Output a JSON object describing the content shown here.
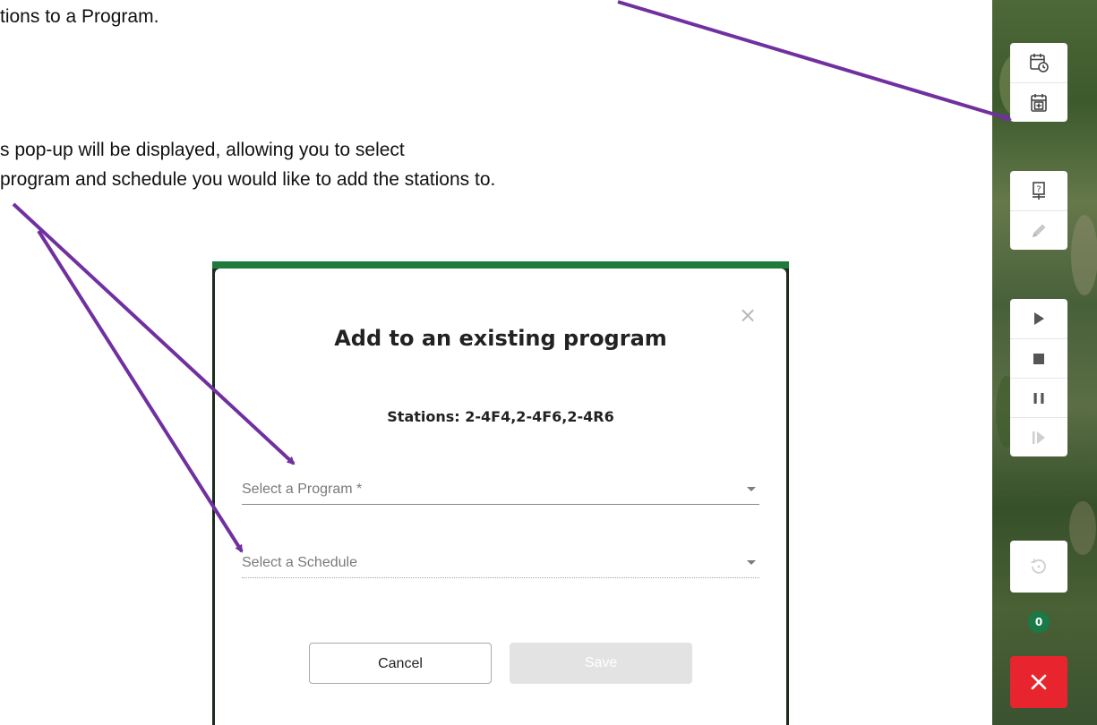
{
  "instructions": {
    "line1": "tions to a Program.",
    "line2": "s pop-up will be displayed, allowing you to select",
    "line3": " program and schedule you would like to add the stations to."
  },
  "dialog": {
    "close_glyph": "×",
    "title": "Add to an existing program",
    "subtitle": "Stations: 2-4F4,2-4F6,2-4R6",
    "program_select": {
      "placeholder": "Select a Program *"
    },
    "schedule_select": {
      "placeholder": "Select a Schedule"
    },
    "cancel_label": "Cancel",
    "save_label": "Save"
  },
  "toolbar": {
    "groups": [
      {
        "items": [
          {
            "icon": "calendar-clock-icon"
          },
          {
            "icon": "calendar-add-icon"
          }
        ]
      },
      {
        "items": [
          {
            "icon": "help-monitor-icon"
          },
          {
            "icon": "pencil-icon"
          }
        ]
      },
      {
        "items": [
          {
            "icon": "play-icon"
          },
          {
            "icon": "stop-icon"
          },
          {
            "icon": "pause-icon"
          },
          {
            "icon": "step-forward-icon"
          }
        ]
      },
      {
        "items": [
          {
            "icon": "history-icon"
          }
        ]
      }
    ],
    "badge_count": "0",
    "close_icon": "close-icon"
  },
  "colors": {
    "annotation_arrow": "#7030a0",
    "dialog_accent": "#1f7a3c",
    "badge": "#197a47",
    "close_button": "#e8252f"
  }
}
